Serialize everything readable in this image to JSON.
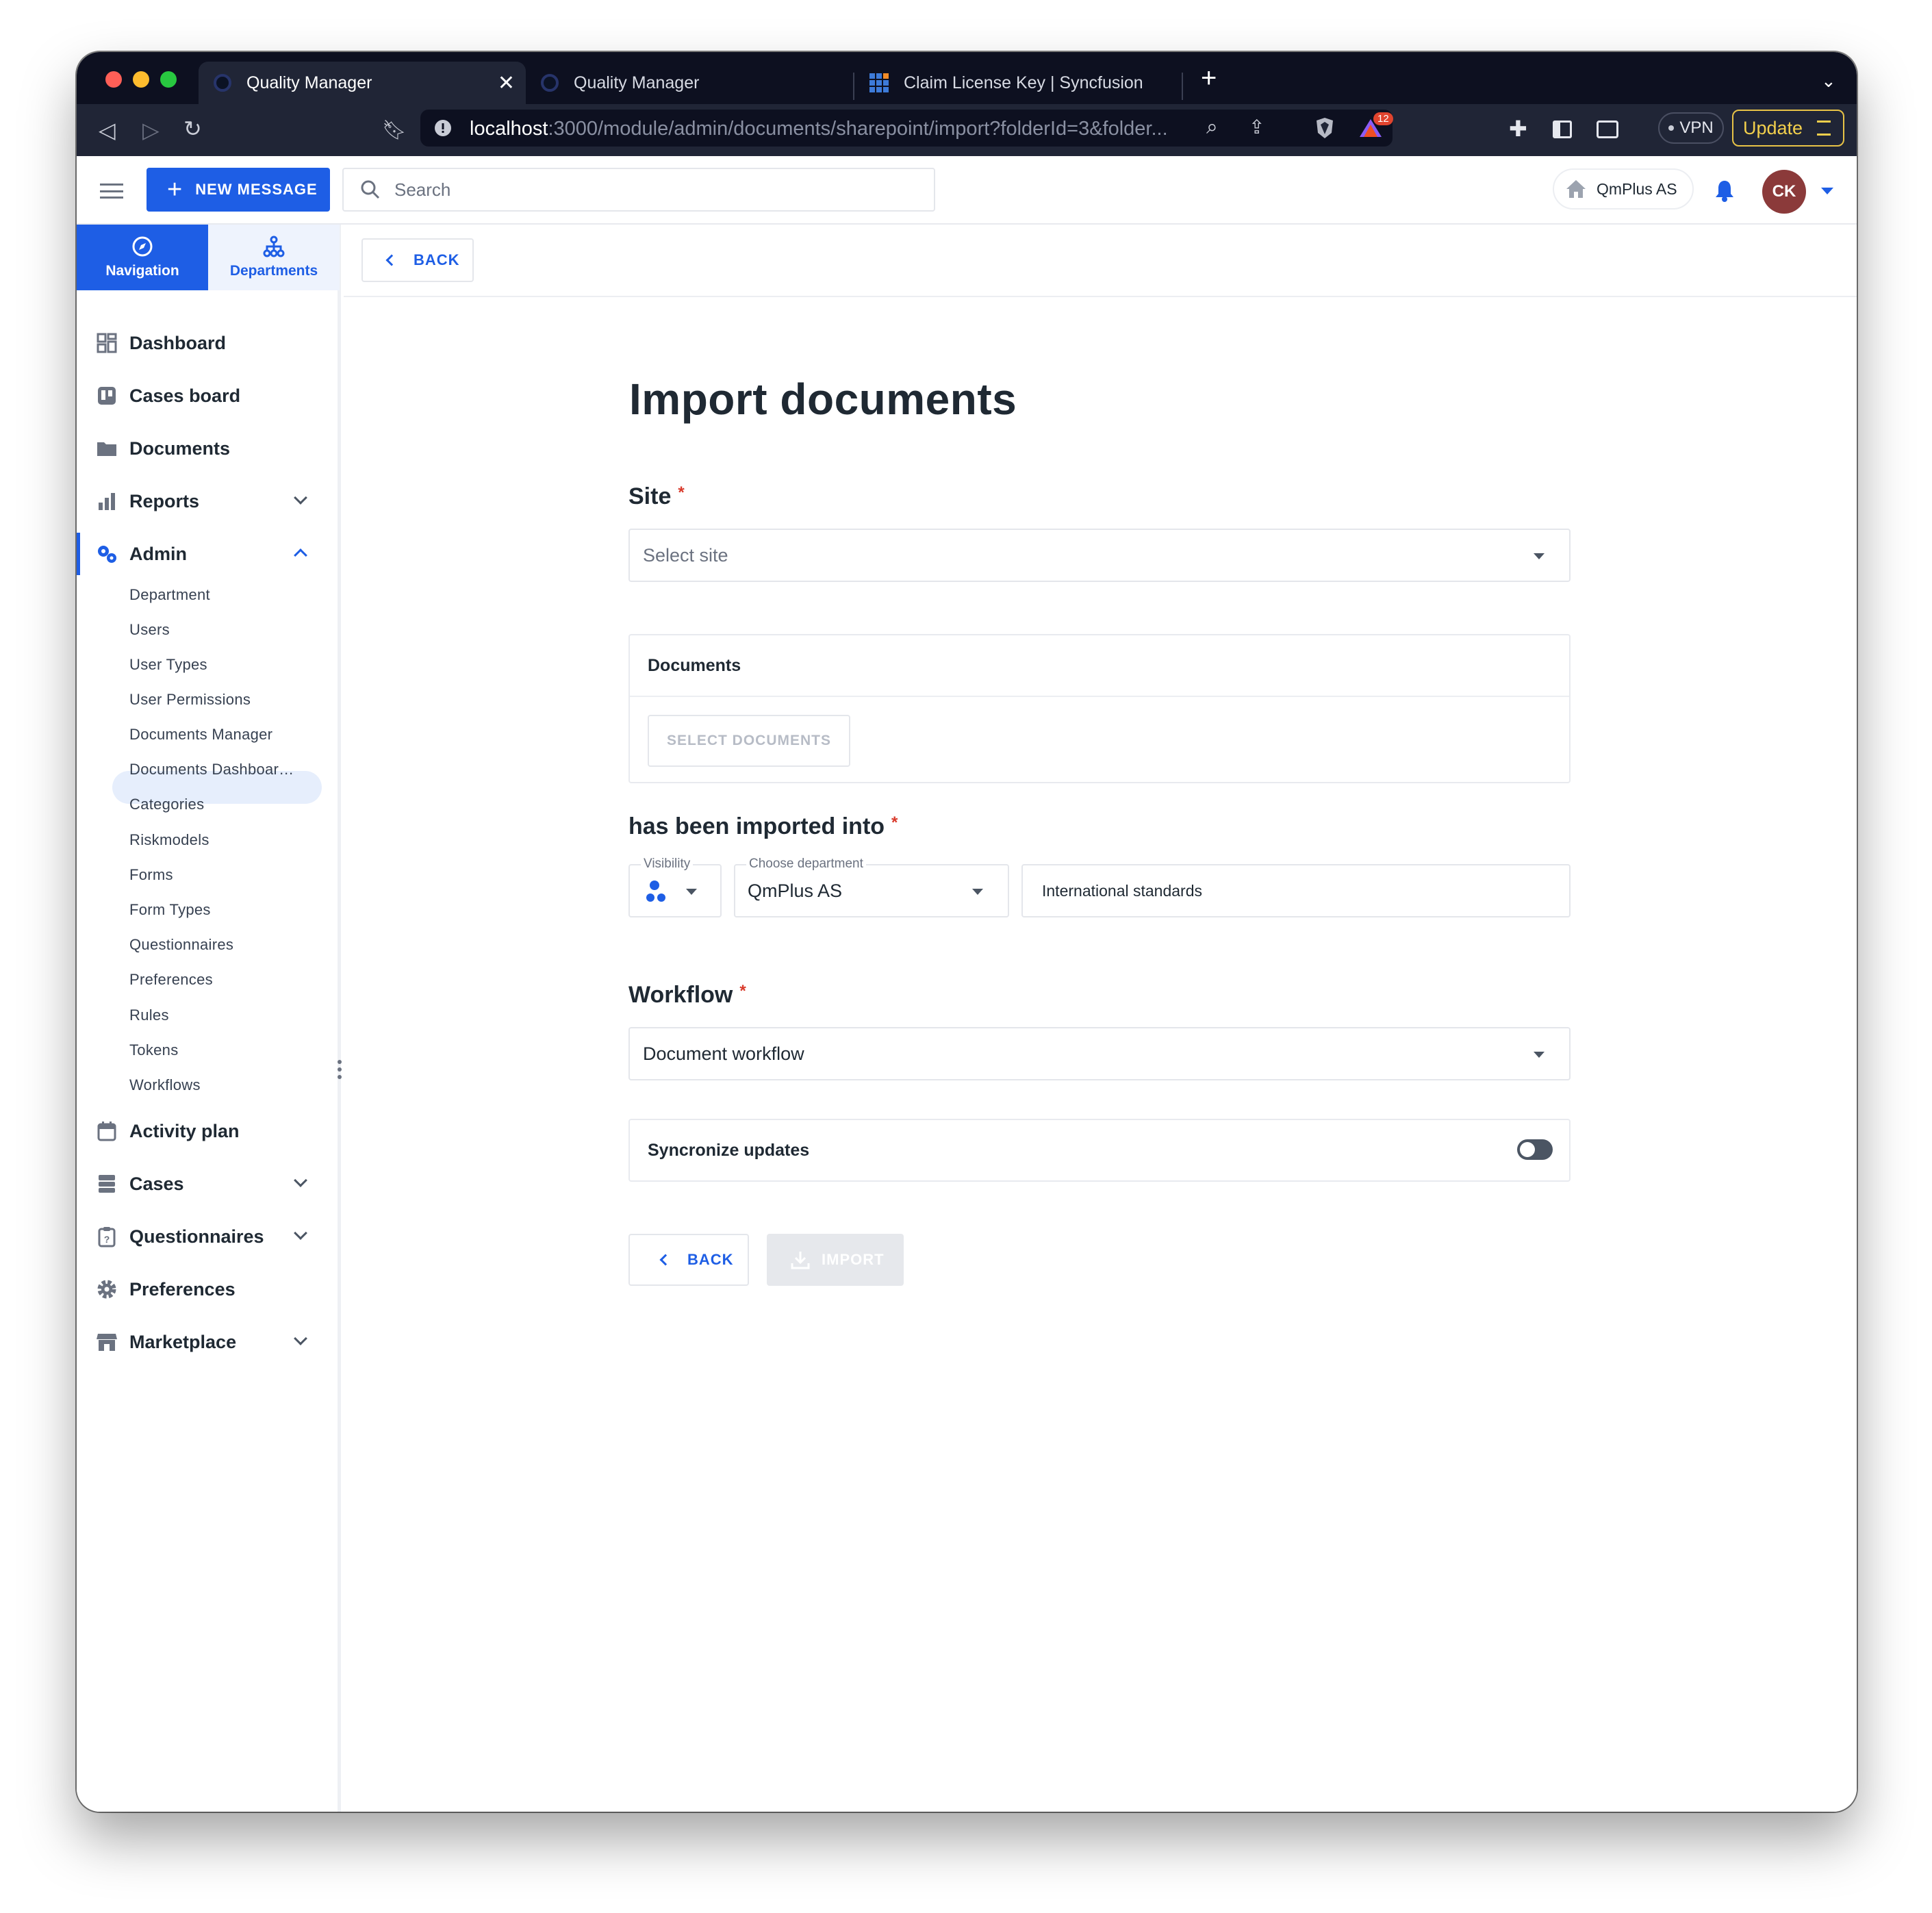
{
  "browser": {
    "tabs": [
      {
        "title": "Quality Manager",
        "active": true
      },
      {
        "title": "Quality Manager",
        "active": false
      },
      {
        "title": "Claim License Key | Syncfusion",
        "active": false
      }
    ],
    "url_host": "localhost",
    "url_rest": ":3000/module/admin/documents/sharepoint/import?folderId=3&folder...",
    "badge_count": "12",
    "vpn_label": "VPN",
    "update_label": "Update"
  },
  "topbar": {
    "new_message_label": "NEW MESSAGE",
    "search_placeholder": "Search",
    "company": "QmPlus AS",
    "avatar_initials": "CK"
  },
  "sidebar": {
    "tabs": [
      {
        "label": "Navigation",
        "active": true
      },
      {
        "label": "Departments",
        "active": false
      }
    ],
    "items": [
      {
        "label": "Dashboard"
      },
      {
        "label": "Cases board"
      },
      {
        "label": "Documents"
      },
      {
        "label": "Reports"
      },
      {
        "label": "Admin"
      },
      {
        "label": "Activity plan"
      },
      {
        "label": "Cases"
      },
      {
        "label": "Questionnaires"
      },
      {
        "label": "Preferences"
      },
      {
        "label": "Marketplace"
      }
    ],
    "admin_subitems": [
      "Department",
      "Users",
      "User Types",
      "User Permissions",
      "Documents Manager",
      "Documents Dashboar…",
      "Categories",
      "Riskmodels",
      "Forms",
      "Form Types",
      "Questionnaires",
      "Preferences",
      "Rules",
      "Tokens",
      "Workflows"
    ],
    "selected_subitem": "Documents Manager"
  },
  "main": {
    "back_label": "BACK",
    "title": "Import documents",
    "site_label": "Site",
    "required_mark": "*",
    "site_placeholder": "Select site",
    "documents_card_title": "Documents",
    "select_documents_label": "SELECT DOCUMENTS",
    "imported_into_label": "has been imported into",
    "visibility_label": "Visibility",
    "department_label": "Choose department",
    "department_value": "QmPlus AS",
    "folder_value": "International standards",
    "workflow_label": "Workflow",
    "workflow_value": "Document workflow",
    "sync_label": "Syncronize updates",
    "sync_enabled": false,
    "bottom_back_label": "BACK",
    "import_label": "IMPORT"
  },
  "colors": {
    "accent": "#1e5ee5",
    "required": "#d93a2b",
    "avatar_bg": "#8b3a3a"
  }
}
